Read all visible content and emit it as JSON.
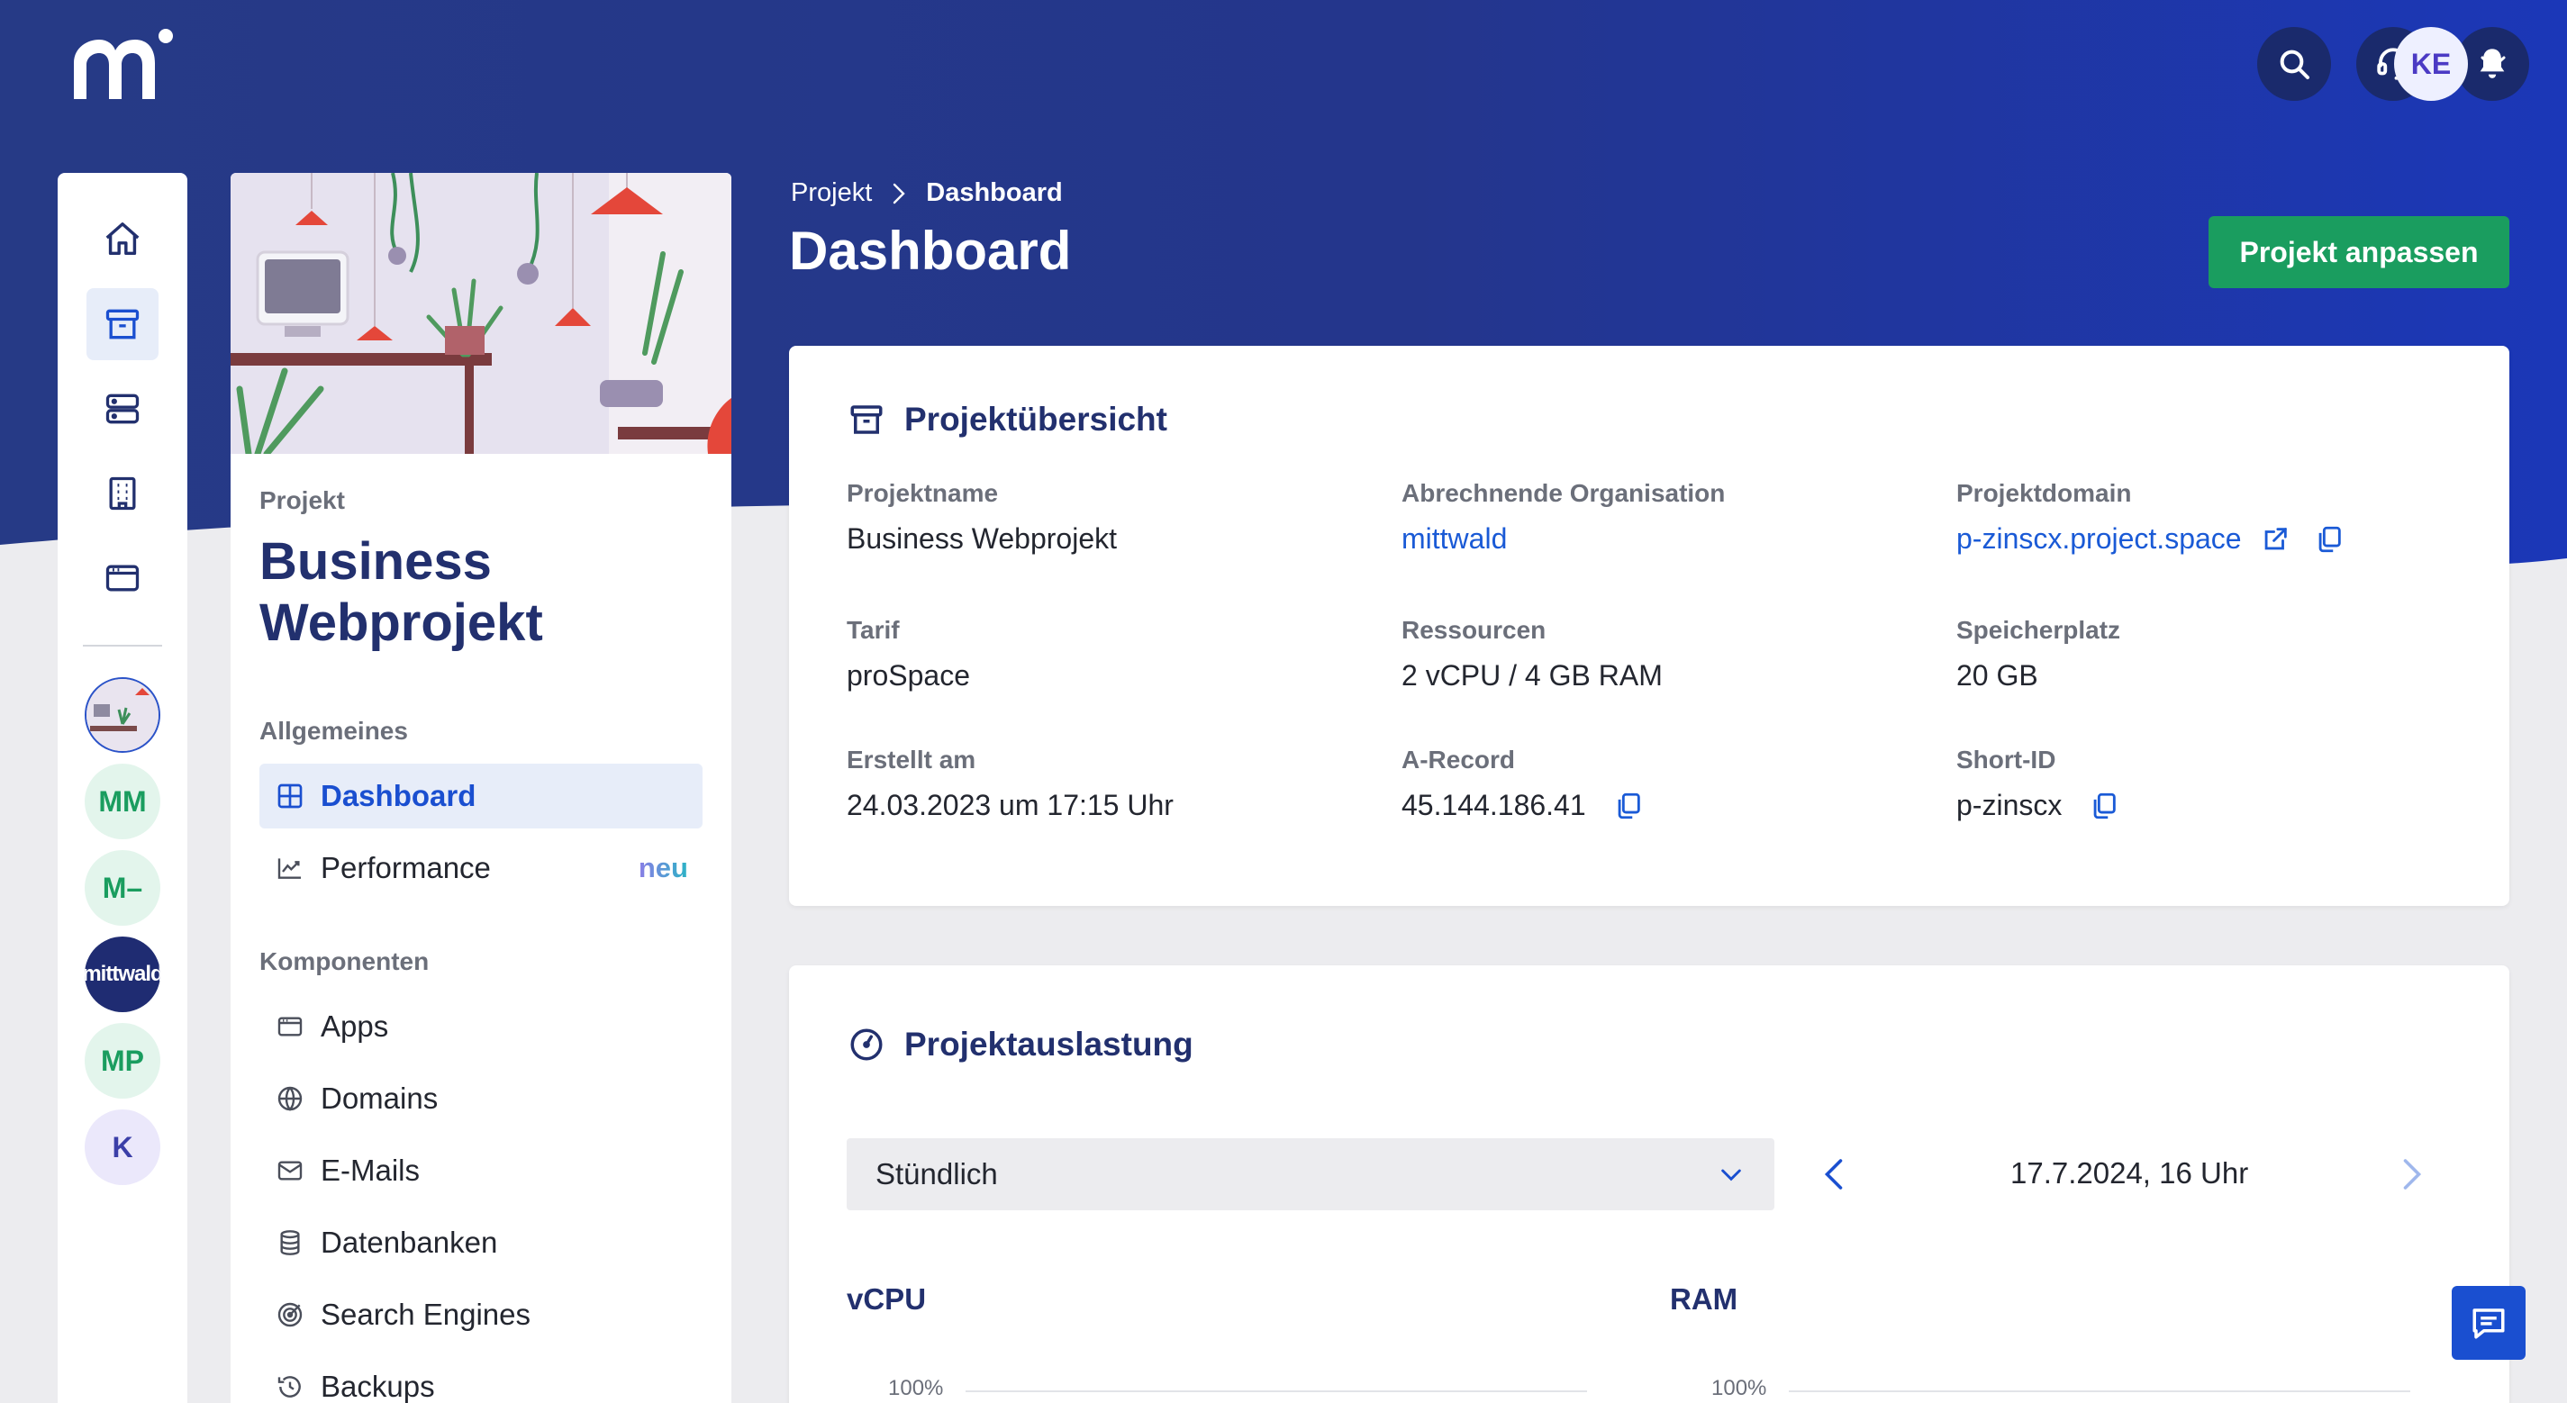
{
  "header": {
    "logo_text": "m",
    "user_initials": "KE",
    "icons": [
      "search-icon",
      "support-headset-icon",
      "bell-icon",
      "chevron-down-icon"
    ]
  },
  "rail": {
    "icons": [
      "home-icon",
      "project-box-icon",
      "server-icon",
      "building-icon",
      "browser-icon"
    ],
    "avatars": [
      {
        "initials": ""
      },
      {
        "initials": "MM"
      },
      {
        "initials": "M–"
      },
      {
        "initials": "mittwald"
      },
      {
        "initials": "MP"
      },
      {
        "initials": "K"
      }
    ]
  },
  "project_panel": {
    "label": "Projekt",
    "name": "Business Webprojekt",
    "sections": [
      {
        "title": "Allgemeines",
        "items": [
          {
            "label": "Dashboard",
            "icon": "dashboard-grid-icon",
            "active": true
          },
          {
            "label": "Performance",
            "icon": "chart-trend-icon",
            "badge": "neu"
          }
        ]
      },
      {
        "title": "Komponenten",
        "items": [
          {
            "label": "Apps",
            "icon": "apps-window-icon"
          },
          {
            "label": "Domains",
            "icon": "globe-icon"
          },
          {
            "label": "E-Mails",
            "icon": "mail-icon"
          },
          {
            "label": "Datenbanken",
            "icon": "database-icon"
          },
          {
            "label": "Search Engines",
            "icon": "target-icon"
          },
          {
            "label": "Backups",
            "icon": "history-icon"
          }
        ]
      }
    ]
  },
  "breadcrumb": {
    "parent": "Projekt",
    "current": "Dashboard"
  },
  "page": {
    "title": "Dashboard",
    "primary_button": "Projekt anpassen"
  },
  "overview": {
    "title": "Projektübersicht",
    "fields": [
      {
        "label": "Projektname",
        "value": "Business Webprojekt"
      },
      {
        "label": "Abrechnende Organisation",
        "value": "mittwald",
        "link": true
      },
      {
        "label": "Projektdomain",
        "value": "p-zinscx.project.space",
        "link": true
      },
      {
        "label": "Tarif",
        "value": "proSpace"
      },
      {
        "label": "Ressourcen",
        "value": "2 vCPU / 4 GB RAM"
      },
      {
        "label": "Speicherplatz",
        "value": "20 GB"
      },
      {
        "label": "Erstellt am",
        "value": "24.03.2023 um 17:15 Uhr"
      },
      {
        "label": "A-Record",
        "value": "45.144.186.41"
      },
      {
        "label": "Short-ID",
        "value": "p-zinscx"
      }
    ]
  },
  "usage": {
    "title": "Projektauslastung",
    "interval_select": "Stündlich",
    "date_label": "17.7.2024, 16 Uhr",
    "charts": [
      {
        "title": "vCPU",
        "axis_top": "100%"
      },
      {
        "title": "RAM",
        "axis_top": "100%"
      }
    ]
  }
}
